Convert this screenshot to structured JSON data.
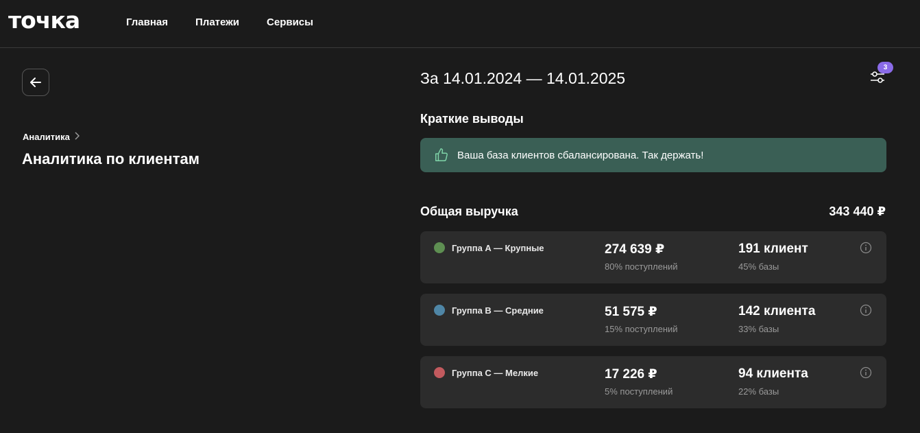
{
  "header": {
    "logo": "точка",
    "nav": [
      {
        "label": "Главная"
      },
      {
        "label": "Платежи"
      },
      {
        "label": "Сервисы"
      }
    ]
  },
  "sidebar": {
    "breadcrumb": "Аналитика",
    "page_title": "Аналитика по клиентам"
  },
  "main": {
    "period": "За 14.01.2024 — 14.01.2025",
    "filter_badge": "3",
    "summary_title": "Краткие выводы",
    "summary_text": "Ваша база клиентов сбалансирована. Так держать!",
    "revenue_label": "Общая выручка",
    "revenue_total": "343 440 ₽",
    "groups": [
      {
        "name": "Группа A — Крупные",
        "amount": "274 639 ₽",
        "share": "80% поступлений",
        "clients": "191 клиент",
        "base": "45% базы",
        "color": "#5e8f52"
      },
      {
        "name": "Группа B — Средние",
        "amount": "51 575 ₽",
        "share": "15% поступлений",
        "clients": "142 клиента",
        "base": "33% базы",
        "color": "#4f86a6"
      },
      {
        "name": "Группа C — Мелкие",
        "amount": "17 226 ₽",
        "share": "5% поступлений",
        "clients": "94 клиента",
        "base": "22% базы",
        "color": "#c25a5e"
      }
    ]
  },
  "colors": {
    "background": "#1b1b1b",
    "card": "#2c2c2c",
    "banner": "#3a5f55",
    "badge": "#8a6be8"
  }
}
